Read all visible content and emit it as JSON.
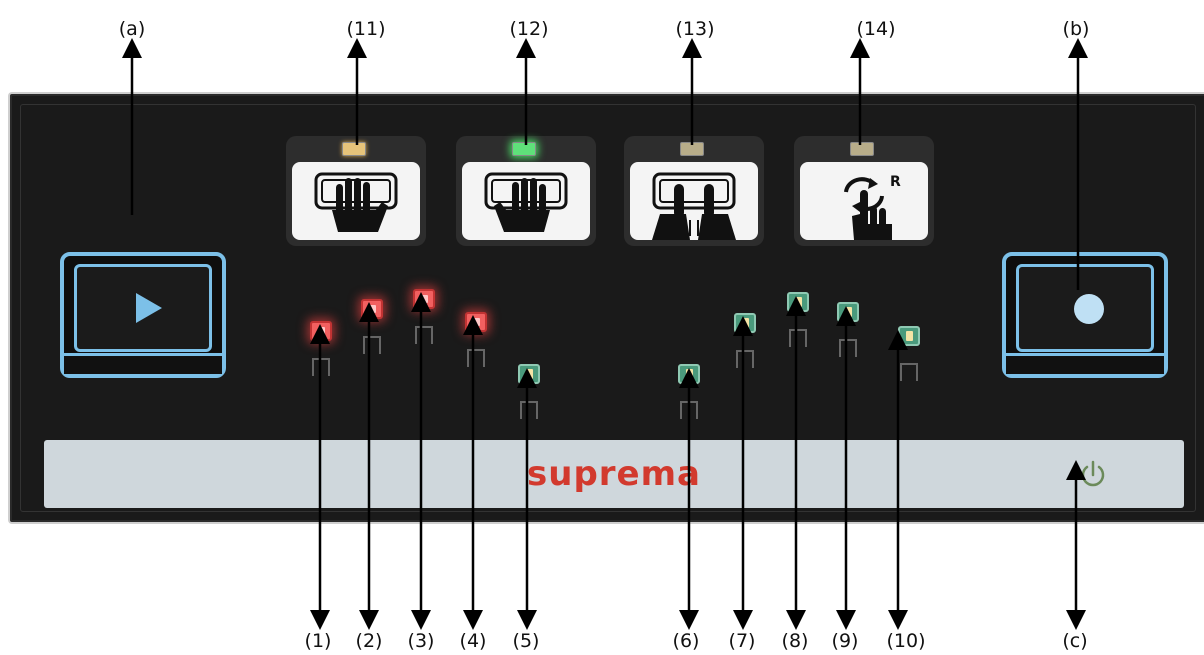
{
  "brand": "suprema",
  "colors": {
    "led_red": "#f26060",
    "led_green_active": "#5fe07a",
    "button_outline": "#7cc0e8",
    "brand_red": "#d23a2e"
  },
  "top_callouts": {
    "a": "(a)",
    "c11": "(11)",
    "c12": "(12)",
    "c13": "(13)",
    "c14": "(14)",
    "b": "(b)"
  },
  "bottom_callouts": {
    "c1": "(1)",
    "c2": "(2)",
    "c3": "(3)",
    "c4": "(4)",
    "c5": "(5)",
    "c6": "(6)",
    "c7": "(7)",
    "c8": "(8)",
    "c9": "(9)",
    "c10": "(10)",
    "c": "(c)"
  },
  "mode_cards": [
    {
      "icon": "left-hand-four-finger-icon",
      "led": "amber"
    },
    {
      "icon": "right-hand-four-finger-icon",
      "led": "green"
    },
    {
      "icon": "two-thumbs-icon",
      "led": "dim"
    },
    {
      "icon": "rolled-finger-icon",
      "label": "R",
      "led": "dim"
    }
  ],
  "side_buttons": {
    "left_icon": "play-icon",
    "right_icon": "record-icon",
    "strip_icon": "power-icon"
  },
  "finger_leds": {
    "left": [
      "red",
      "red",
      "red",
      "red",
      "green"
    ],
    "right": [
      "green",
      "green",
      "green",
      "green",
      "green"
    ]
  }
}
